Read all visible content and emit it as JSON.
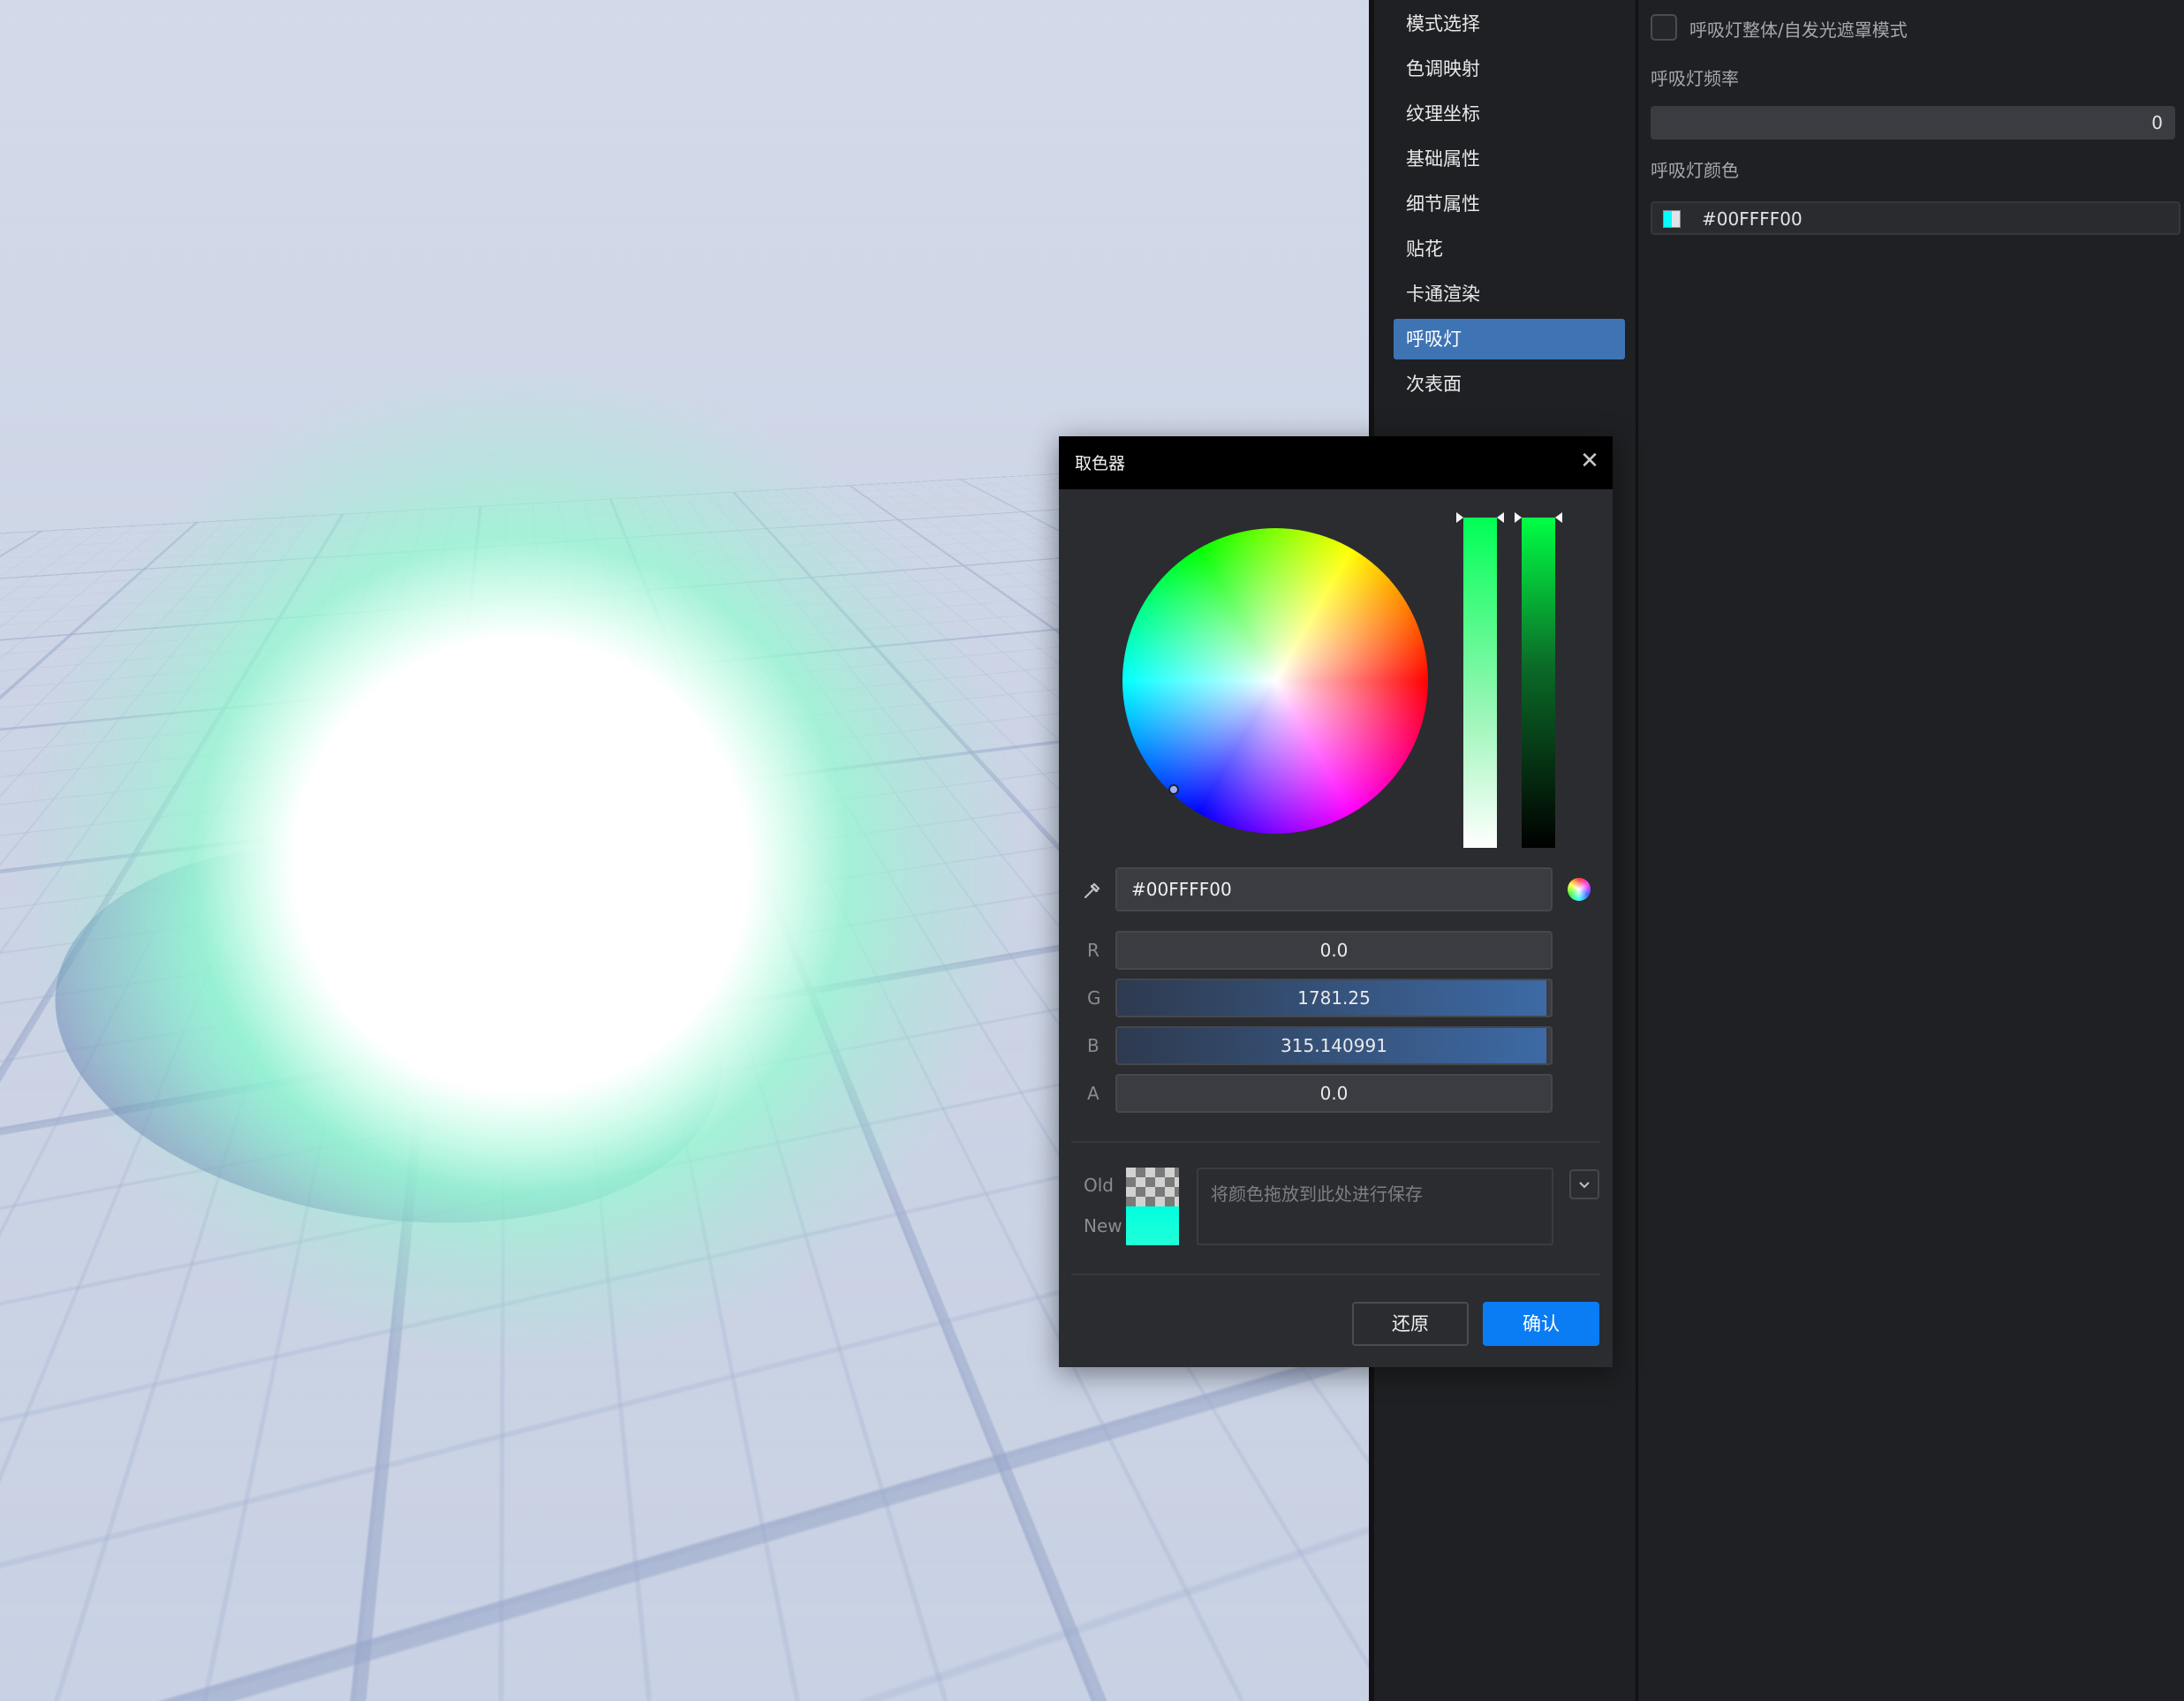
{
  "sidebar": {
    "items": [
      {
        "label": "模式选择"
      },
      {
        "label": "色调映射"
      },
      {
        "label": "纹理坐标"
      },
      {
        "label": "基础属性"
      },
      {
        "label": "细节属性"
      },
      {
        "label": "贴花"
      },
      {
        "label": "卡通渲染"
      },
      {
        "label": "呼吸灯",
        "active": true
      },
      {
        "label": "次表面"
      }
    ]
  },
  "props": {
    "checkbox_label": "呼吸灯整体/自发光遮罩模式",
    "checkbox_checked": false,
    "frequency_label": "呼吸灯频率",
    "frequency_value": "0",
    "color_label": "呼吸灯颜色",
    "color_value": "#00FFFF00"
  },
  "picker": {
    "title": "取色器",
    "close_icon": "✕",
    "hex_value": "#00FFFF00",
    "channels": [
      {
        "label": "R",
        "value": "0.0",
        "fill": 0
      },
      {
        "label": "G",
        "value": "1781.25",
        "fill": 0.99
      },
      {
        "label": "B",
        "value": "315.140991",
        "fill": 0.99
      },
      {
        "label": "A",
        "value": "0.0",
        "fill": 0
      }
    ],
    "old_label": "Old",
    "new_label": "New",
    "drop_placeholder": "将颜色拖放到此处进行保存",
    "reset_label": "还原",
    "confirm_label": "确认",
    "accent_color": "#0a7cf4"
  }
}
